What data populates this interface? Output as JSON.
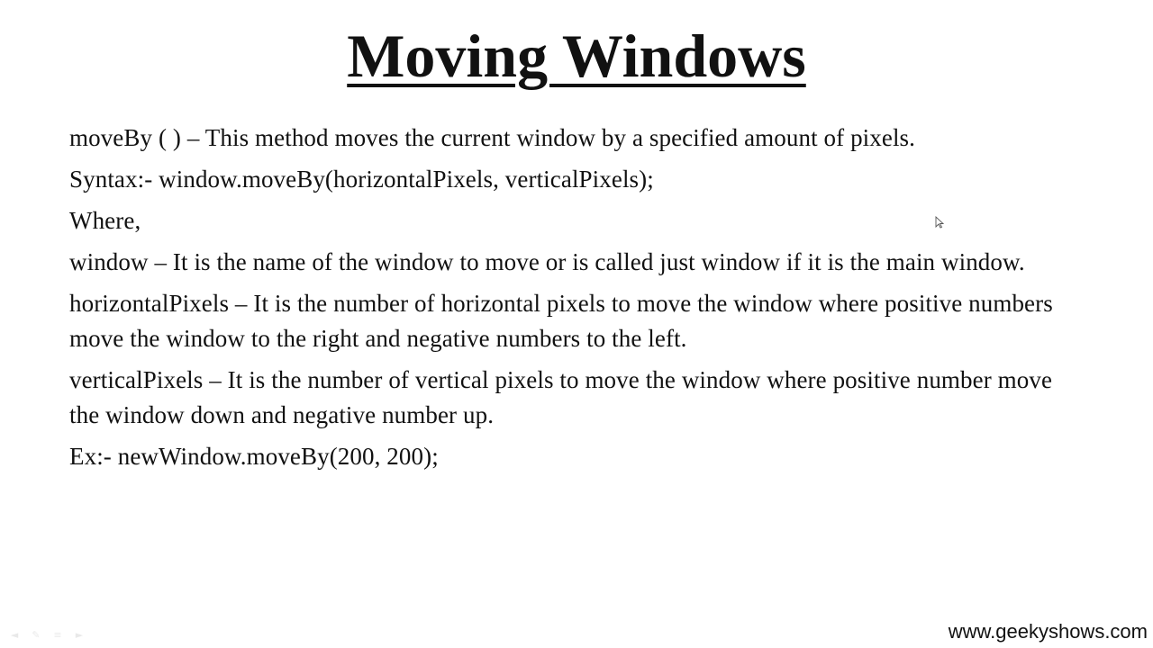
{
  "slide": {
    "title": "Moving Windows",
    "paragraphs": [
      "moveBy ( ) – This method moves the current window by a specified amount of pixels.",
      "Syntax:- window.moveBy(horizontalPixels, verticalPixels);",
      "Where,",
      "window – It is the name of the window to move or is called just window if it is the main window.",
      "horizontalPixels – It is the number of horizontal pixels to move the window where positive numbers move the window to the right and negative numbers to the left.",
      "verticalPixels – It is the number of vertical pixels to move the window where positive number move the window down and negative number up.",
      "Ex:- newWindow.moveBy(200, 200);"
    ],
    "footer_url": "www.geekyshows.com"
  },
  "controls": {
    "icons": [
      "previous-slide-icon",
      "pen-icon",
      "menu-icon",
      "next-slide-icon"
    ]
  },
  "colors": {
    "background": "#ffffff",
    "text": "#111111"
  }
}
